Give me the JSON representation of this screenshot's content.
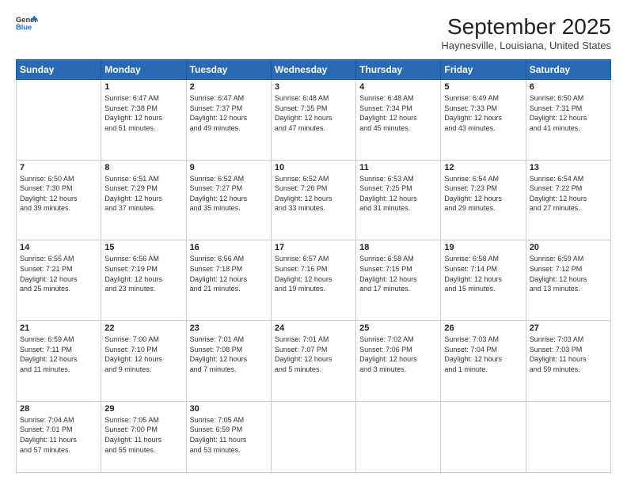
{
  "logo": {
    "line1": "General",
    "line2": "Blue"
  },
  "title": "September 2025",
  "location": "Haynesville, Louisiana, United States",
  "weekdays": [
    "Sunday",
    "Monday",
    "Tuesday",
    "Wednesday",
    "Thursday",
    "Friday",
    "Saturday"
  ],
  "weeks": [
    [
      {
        "day": "",
        "data": ""
      },
      {
        "day": "1",
        "data": "Sunrise: 6:47 AM\nSunset: 7:38 PM\nDaylight: 12 hours\nand 51 minutes."
      },
      {
        "day": "2",
        "data": "Sunrise: 6:47 AM\nSunset: 7:37 PM\nDaylight: 12 hours\nand 49 minutes."
      },
      {
        "day": "3",
        "data": "Sunrise: 6:48 AM\nSunset: 7:35 PM\nDaylight: 12 hours\nand 47 minutes."
      },
      {
        "day": "4",
        "data": "Sunrise: 6:48 AM\nSunset: 7:34 PM\nDaylight: 12 hours\nand 45 minutes."
      },
      {
        "day": "5",
        "data": "Sunrise: 6:49 AM\nSunset: 7:33 PM\nDaylight: 12 hours\nand 43 minutes."
      },
      {
        "day": "6",
        "data": "Sunrise: 6:50 AM\nSunset: 7:31 PM\nDaylight: 12 hours\nand 41 minutes."
      }
    ],
    [
      {
        "day": "7",
        "data": "Sunrise: 6:50 AM\nSunset: 7:30 PM\nDaylight: 12 hours\nand 39 minutes."
      },
      {
        "day": "8",
        "data": "Sunrise: 6:51 AM\nSunset: 7:29 PM\nDaylight: 12 hours\nand 37 minutes."
      },
      {
        "day": "9",
        "data": "Sunrise: 6:52 AM\nSunset: 7:27 PM\nDaylight: 12 hours\nand 35 minutes."
      },
      {
        "day": "10",
        "data": "Sunrise: 6:52 AM\nSunset: 7:26 PM\nDaylight: 12 hours\nand 33 minutes."
      },
      {
        "day": "11",
        "data": "Sunrise: 6:53 AM\nSunset: 7:25 PM\nDaylight: 12 hours\nand 31 minutes."
      },
      {
        "day": "12",
        "data": "Sunrise: 6:54 AM\nSunset: 7:23 PM\nDaylight: 12 hours\nand 29 minutes."
      },
      {
        "day": "13",
        "data": "Sunrise: 6:54 AM\nSunset: 7:22 PM\nDaylight: 12 hours\nand 27 minutes."
      }
    ],
    [
      {
        "day": "14",
        "data": "Sunrise: 6:55 AM\nSunset: 7:21 PM\nDaylight: 12 hours\nand 25 minutes."
      },
      {
        "day": "15",
        "data": "Sunrise: 6:56 AM\nSunset: 7:19 PM\nDaylight: 12 hours\nand 23 minutes."
      },
      {
        "day": "16",
        "data": "Sunrise: 6:56 AM\nSunset: 7:18 PM\nDaylight: 12 hours\nand 21 minutes."
      },
      {
        "day": "17",
        "data": "Sunrise: 6:57 AM\nSunset: 7:16 PM\nDaylight: 12 hours\nand 19 minutes."
      },
      {
        "day": "18",
        "data": "Sunrise: 6:58 AM\nSunset: 7:15 PM\nDaylight: 12 hours\nand 17 minutes."
      },
      {
        "day": "19",
        "data": "Sunrise: 6:58 AM\nSunset: 7:14 PM\nDaylight: 12 hours\nand 15 minutes."
      },
      {
        "day": "20",
        "data": "Sunrise: 6:59 AM\nSunset: 7:12 PM\nDaylight: 12 hours\nand 13 minutes."
      }
    ],
    [
      {
        "day": "21",
        "data": "Sunrise: 6:59 AM\nSunset: 7:11 PM\nDaylight: 12 hours\nand 11 minutes."
      },
      {
        "day": "22",
        "data": "Sunrise: 7:00 AM\nSunset: 7:10 PM\nDaylight: 12 hours\nand 9 minutes."
      },
      {
        "day": "23",
        "data": "Sunrise: 7:01 AM\nSunset: 7:08 PM\nDaylight: 12 hours\nand 7 minutes."
      },
      {
        "day": "24",
        "data": "Sunrise: 7:01 AM\nSunset: 7:07 PM\nDaylight: 12 hours\nand 5 minutes."
      },
      {
        "day": "25",
        "data": "Sunrise: 7:02 AM\nSunset: 7:06 PM\nDaylight: 12 hours\nand 3 minutes."
      },
      {
        "day": "26",
        "data": "Sunrise: 7:03 AM\nSunset: 7:04 PM\nDaylight: 12 hours\nand 1 minute."
      },
      {
        "day": "27",
        "data": "Sunrise: 7:03 AM\nSunset: 7:03 PM\nDaylight: 11 hours\nand 59 minutes."
      }
    ],
    [
      {
        "day": "28",
        "data": "Sunrise: 7:04 AM\nSunset: 7:01 PM\nDaylight: 11 hours\nand 57 minutes."
      },
      {
        "day": "29",
        "data": "Sunrise: 7:05 AM\nSunset: 7:00 PM\nDaylight: 11 hours\nand 55 minutes."
      },
      {
        "day": "30",
        "data": "Sunrise: 7:05 AM\nSunset: 6:59 PM\nDaylight: 11 hours\nand 53 minutes."
      },
      {
        "day": "",
        "data": ""
      },
      {
        "day": "",
        "data": ""
      },
      {
        "day": "",
        "data": ""
      },
      {
        "day": "",
        "data": ""
      }
    ]
  ]
}
